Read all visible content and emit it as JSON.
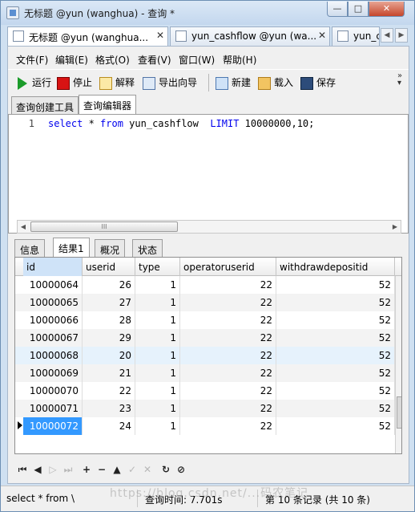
{
  "window": {
    "title": "无标题 @yun (wanghua) - 查询 *",
    "minimize": "—",
    "maximize": "□",
    "close": "✕"
  },
  "doc_tabs": [
    {
      "label": "无标题 @yun (wanghua..."
    },
    {
      "label": "yun_cashflow @yun (wa..."
    },
    {
      "label": "yun_c"
    }
  ],
  "menu": [
    "文件(F)",
    "编辑(E)",
    "格式(O)",
    "查看(V)",
    "窗口(W)",
    "帮助(H)"
  ],
  "toolbar": {
    "run": "运行",
    "stop": "停止",
    "explain": "解释",
    "export": "导出向导",
    "new": "新建",
    "load": "载入",
    "save": "保存"
  },
  "query_tabs": [
    "查询创建工具",
    "查询编辑器"
  ],
  "editor": {
    "line_number": "1",
    "code": {
      "kw1": "select",
      "p1": " * ",
      "kw2": "from",
      "p2": " yun_cashflow  ",
      "kw3": "LIMIT",
      "p3": " 10000000,10;"
    }
  },
  "result_tabs": [
    "信息",
    "结果1",
    "概况",
    "状态"
  ],
  "grid": {
    "columns": [
      "id",
      "userid",
      "type",
      "operatoruserid",
      "withdrawdepositid"
    ],
    "rows": [
      [
        "10000064",
        "26",
        "1",
        "22",
        "52"
      ],
      [
        "10000065",
        "27",
        "1",
        "22",
        "52"
      ],
      [
        "10000066",
        "28",
        "1",
        "22",
        "52"
      ],
      [
        "10000067",
        "29",
        "1",
        "22",
        "52"
      ],
      [
        "10000068",
        "20",
        "1",
        "22",
        "52"
      ],
      [
        "10000069",
        "21",
        "1",
        "22",
        "52"
      ],
      [
        "10000070",
        "22",
        "1",
        "22",
        "52"
      ],
      [
        "10000071",
        "23",
        "1",
        "22",
        "52"
      ],
      [
        "10000072",
        "24",
        "1",
        "22",
        "52"
      ]
    ],
    "selected_row": 8
  },
  "navbar": [
    "⏮",
    "◀",
    "▷",
    "⏭",
    "+",
    "−",
    "▲",
    "✓",
    "✕",
    "↻",
    "⊘"
  ],
  "status": {
    "sql": "select * from \\",
    "time": "查询时间: 7.701s",
    "records": "第 10 条记录 (共 10 条)"
  },
  "watermark": "https://blog.csdn.net/...码农笔记"
}
